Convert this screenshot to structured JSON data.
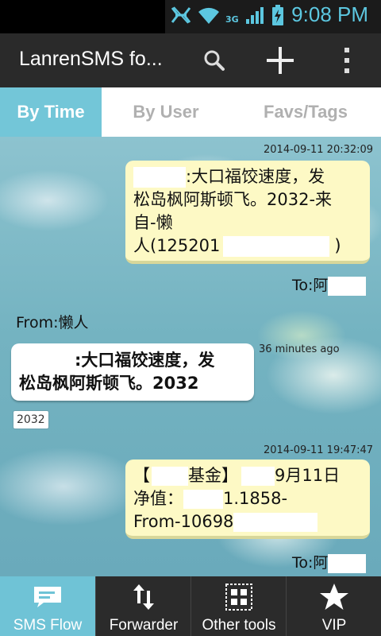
{
  "status_bar": {
    "time": "9:08 PM",
    "icons": [
      "signal-blocked-icon",
      "wifi-icon",
      "3g-icon",
      "cell-signal-icon",
      "battery-charging-icon"
    ]
  },
  "action_bar": {
    "title": "LanrenSMS fo...",
    "actions": [
      "search-icon",
      "add-icon",
      "overflow-menu-icon"
    ]
  },
  "tabs": [
    {
      "label": "By Time",
      "active": true
    },
    {
      "label": "By User",
      "active": false
    },
    {
      "label": "Favs/Tags",
      "active": false
    }
  ],
  "messages": [
    {
      "direction": "out",
      "timestamp": "2014-09-11 20:32:09",
      "lines": [
        ":大口福饺速度，发",
        "松岛枫阿斯顿飞。2032-来",
        "自-懒",
        "人(125201",
        ")"
      ],
      "to": "To:阿"
    },
    {
      "direction": "in",
      "from": "From:懒人",
      "timestamp": "36 minutes ago",
      "lines": [
        ":大口福饺速度，发",
        "松岛枫阿斯顿飞。2032"
      ],
      "tag": "2032"
    },
    {
      "direction": "out",
      "timestamp": "2014-09-11 19:47:47",
      "lines": [
        "【",
        "基金】",
        "9月11日",
        "净值：",
        "1.1858-",
        "From-10698"
      ],
      "to": "To:阿"
    }
  ],
  "bottom_nav": [
    {
      "label": "SMS Flow",
      "icon": "sms-flow-icon",
      "active": true
    },
    {
      "label": "Forwarder",
      "icon": "forward-arrows-icon",
      "active": false
    },
    {
      "label": "Other tools",
      "icon": "grid-tools-icon",
      "active": false
    },
    {
      "label": "VIP",
      "icon": "star-icon",
      "active": false
    }
  ],
  "colors": {
    "accent": "#73c6d8",
    "status_time": "#5cc7e0",
    "action_bar": "#2a2a2a",
    "out_bubble": "#fdf9c5"
  }
}
